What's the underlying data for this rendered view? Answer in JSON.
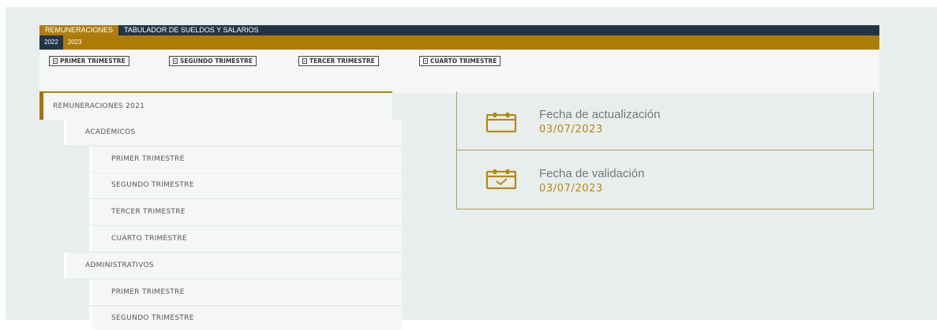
{
  "tabs": [
    {
      "label": "REMUNERACIONES",
      "active": true
    },
    {
      "label": "TABULADOR DE SUELDOS Y SALARIOS",
      "active": false
    }
  ],
  "years": [
    {
      "label": "2022",
      "active": true
    },
    {
      "label": "2023",
      "active": false
    }
  ],
  "quarter_buttons": [
    "PRIMER TRIMESTRE",
    "SEGUNDO TRIMESTRE",
    "TERCER TRIMESTRE",
    "CUARTO TRIMESTRE"
  ],
  "sidebar": {
    "section_title": "REMUNERACIONES 2021",
    "groups": [
      {
        "label": "ACADÉMICOS",
        "items": [
          "PRIMER TRIMESTRE",
          "SEGUNDO TRIMESTRE",
          "TERCER TRIMESTRE",
          "CUARTO TRIMESTRE"
        ]
      },
      {
        "label": "ADMINISTRATIVOS",
        "items": [
          "PRIMER TRIMESTRE",
          "SEGUNDO TRIMESTRE"
        ]
      }
    ]
  },
  "info": {
    "updated_label": "Fecha de actualización",
    "updated_date": "03/07/2023",
    "validated_label": "Fecha de validación",
    "validated_date": "03/07/2023"
  },
  "colors": {
    "navy": "#213547",
    "gold": "#ad7c07",
    "background": "#e8eeee"
  },
  "icons": [
    "document-icon",
    "calendar-icon",
    "calendar-check-icon"
  ]
}
